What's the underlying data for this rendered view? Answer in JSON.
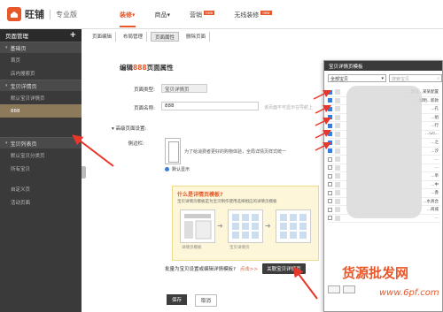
{
  "brand": {
    "name": "旺铺",
    "edition": "专业版"
  },
  "main_nav": [
    {
      "label": "装修",
      "caret": "▾",
      "active": true,
      "badge": ""
    },
    {
      "label": "商品",
      "caret": "▾",
      "active": false,
      "badge": ""
    },
    {
      "label": "营销",
      "caret": "",
      "active": false,
      "badge": "new"
    },
    {
      "label": "无线装修",
      "caret": "",
      "active": false,
      "badge": "new"
    }
  ],
  "sidebar": {
    "title": "页面管理",
    "add_icon": "+",
    "groups": [
      {
        "label": "基础页",
        "items": [
          {
            "label": "首页",
            "selected": false
          },
          {
            "label": "店内搜索页",
            "selected": false
          }
        ]
      },
      {
        "label": "宝贝详情页",
        "items": [
          {
            "label": "默认宝贝详情页",
            "selected": false
          },
          {
            "label": "888",
            "selected": true
          }
        ]
      },
      {
        "label": "宝贝列表页",
        "items": [
          {
            "label": "默认宝贝分类页",
            "selected": false
          },
          {
            "label": "所有宝贝",
            "selected": false
          }
        ]
      },
      {
        "label": "",
        "items": [
          {
            "label": "自定义页",
            "selected": false
          },
          {
            "label": "活动页面",
            "selected": false
          }
        ]
      }
    ]
  },
  "toolbar": [
    {
      "label": "页面编辑",
      "active": false
    },
    {
      "label": "布局管理",
      "active": false
    },
    {
      "label": "页面属性",
      "active": true
    },
    {
      "label": "删除页面",
      "active": false
    }
  ],
  "panel": {
    "title_prefix": "编辑",
    "title_highlight": "888",
    "title_suffix": "页面属性",
    "page_type_label": "页面类型:",
    "page_type_value": "宝贝详情页",
    "page_name_label": "页面名称:",
    "page_name_value": "888",
    "page_name_hint": "该页面不可显示在导航上",
    "advanced_label": "高级页面设置:",
    "sidebar_label": "侧边栏:",
    "sidebar_desc": "为了给消费者更好的购物体验，全局详情页样式统一",
    "radio_label": "默认显示"
  },
  "tip": {
    "title": "什么是详情页模板?",
    "desc": "宝贝详情页模板是为宝贝制作使用选择相应的详情页模板",
    "cap1": "详情页模板",
    "cap2": "宝贝详情页"
  },
  "batch": {
    "label": "批量为宝贝设置或编辑详情模板?",
    "link": "点击>>",
    "button": "关联宝贝详情页"
  },
  "actions": {
    "save": "保存",
    "cancel": "取消"
  },
  "dialog": {
    "title": "宝贝详情页模板",
    "select_value": "全部宝贝",
    "search_placeholder": "搜索宝贝",
    "rows": [
      {
        "text": "...验证...某某配置",
        "checked": true
      },
      {
        "text": "...如明...新款",
        "checked": true
      },
      {
        "text": "...孔",
        "checked": true
      },
      {
        "text": "...组",
        "checked": true
      },
      {
        "text": "...行",
        "checked": true
      },
      {
        "text": "...(2)...",
        "checked": true
      },
      {
        "text": "...之",
        "checked": true
      },
      {
        "text": "...汐",
        "checked": true
      },
      {
        "text": "...",
        "checked": false
      },
      {
        "text": "...",
        "checked": false
      },
      {
        "text": "...单",
        "checked": false
      },
      {
        "text": "...中",
        "checked": false
      },
      {
        "text": "...香",
        "checked": false
      },
      {
        "text": "...水具合",
        "checked": false
      },
      {
        "text": "...商城",
        "checked": false
      },
      {
        "text": "...",
        "checked": false
      }
    ]
  },
  "watermark": {
    "line1": "货源批发网",
    "line2": "www.6pf.com"
  },
  "colors": {
    "accent": "#e8572a",
    "sidebar_bg": "#3a3a3a",
    "selected_bg": "#8c7a5a",
    "arrow": "#e8362a"
  }
}
